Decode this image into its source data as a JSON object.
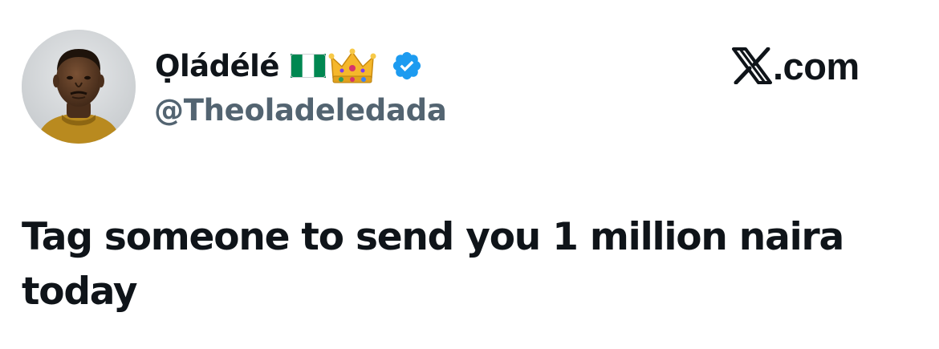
{
  "author": {
    "display_name": "Ọládélé",
    "badges": [
      "nigeria-flag-icon",
      "crown-icon",
      "verified-badge-icon"
    ],
    "handle": "@Theoladeledada"
  },
  "site": {
    "logo": "x-logo-icon",
    "label": ".com"
  },
  "tweet": {
    "text": "Tag someone to send you 1 million naira today"
  },
  "colors": {
    "text_primary": "#0f1419",
    "text_secondary": "#536471",
    "verified_blue": "#1d9bf0",
    "flag_green": "#008751",
    "background": "#ffffff"
  }
}
